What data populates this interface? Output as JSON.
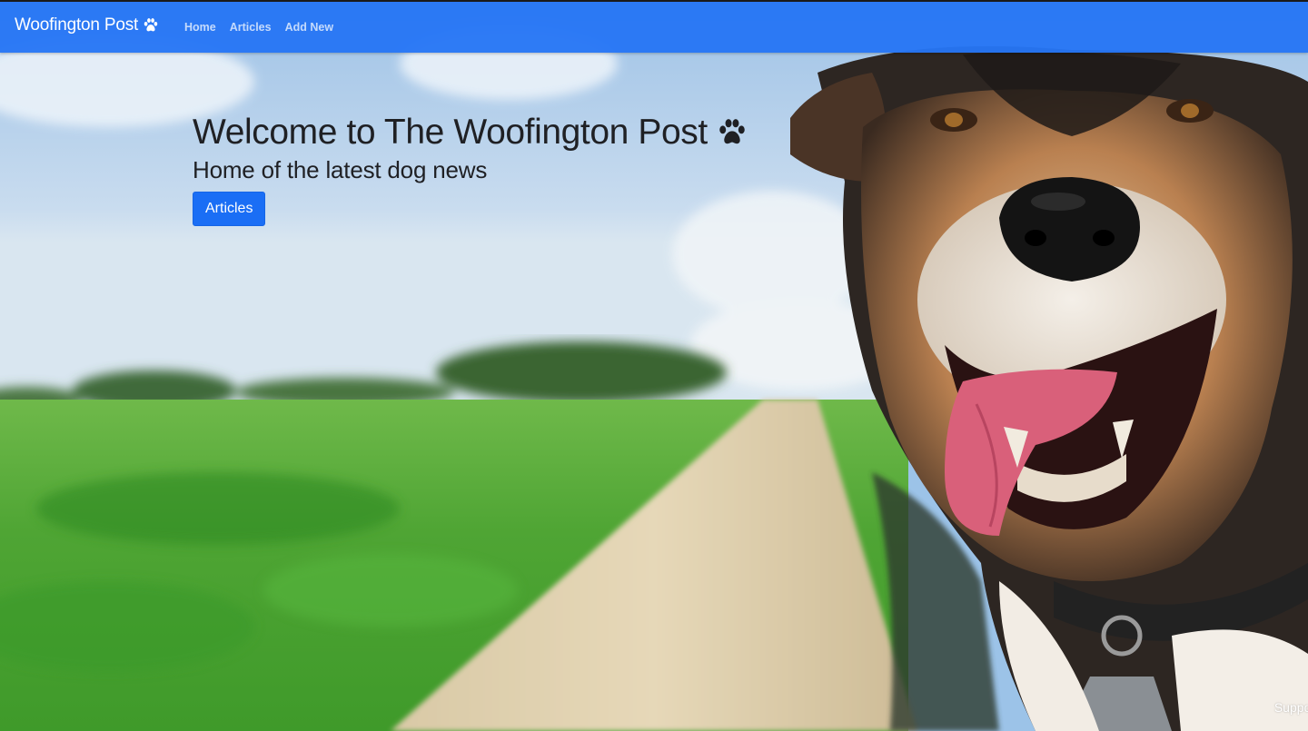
{
  "navbar": {
    "brand": "Woofington Post",
    "brand_icon": "paw-icon",
    "links": [
      {
        "label": "Home"
      },
      {
        "label": "Articles"
      },
      {
        "label": "Add New"
      }
    ],
    "color": "#2776f5"
  },
  "hero": {
    "title": "Welcome to The Woofington Post",
    "title_icon": "paw-icon",
    "subtitle": "Home of the latest dog news",
    "button_label": "Articles",
    "button_color": "#1a6ef5",
    "background": "dog-in-car-window-photo"
  },
  "footer": {
    "support_text": "Suppor"
  }
}
